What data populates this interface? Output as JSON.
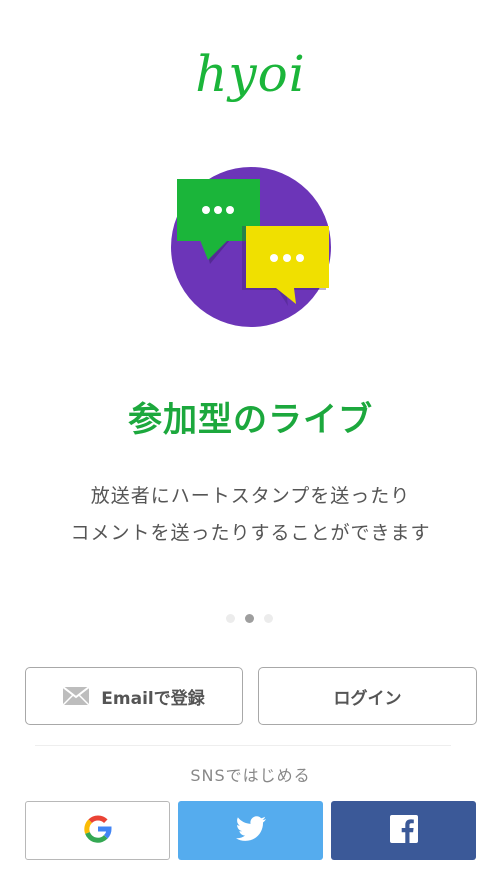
{
  "app": {
    "logo": "hyoi"
  },
  "slide": {
    "headline": "参加型のライブ",
    "description_line1": "放送者にハートスタンプを送ったり",
    "description_line2": "コメントを送ったりすることができます",
    "total_pages": 3,
    "active_page": 2,
    "illustration": {
      "circle_color": "#6c35b8",
      "green_bubble": "#1bb53a",
      "yellow_bubble": "#f0e000"
    }
  },
  "actions": {
    "email_signup_label": "Emailで登録",
    "login_label": "ログイン"
  },
  "sns": {
    "label": "SNSではじめる",
    "buttons": [
      {
        "name": "google",
        "icon": "google-g-icon",
        "color": "#ffffff"
      },
      {
        "name": "twitter",
        "icon": "twitter-bird-icon",
        "color": "#55acee"
      },
      {
        "name": "facebook",
        "icon": "facebook-f-icon",
        "color": "#3b5998"
      }
    ]
  },
  "colors": {
    "brand_green": "#1bb53a",
    "text_gray": "#555555"
  }
}
